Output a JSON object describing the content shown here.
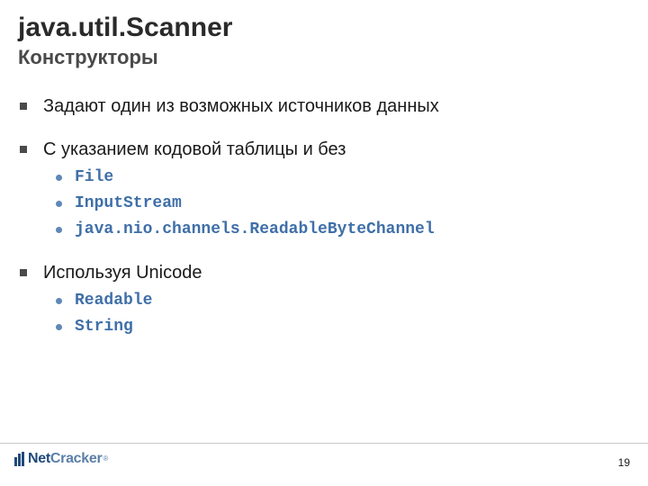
{
  "header": {
    "title": "java.util.Scanner",
    "subtitle": "Конструкторы"
  },
  "bullets": [
    {
      "text": "Задают один из возможных источников данных",
      "sub": []
    },
    {
      "text": "С указанием кодовой таблицы и без",
      "sub": [
        "File",
        "InputStream",
        "java.nio.channels.ReadableByteChannel"
      ]
    },
    {
      "text": "Используя Unicode",
      "sub": [
        "Readable",
        "String"
      ]
    }
  ],
  "footer": {
    "brand_prefix": "Net",
    "brand_suffix": "Cracker",
    "registered": "®",
    "page_number": "19"
  }
}
